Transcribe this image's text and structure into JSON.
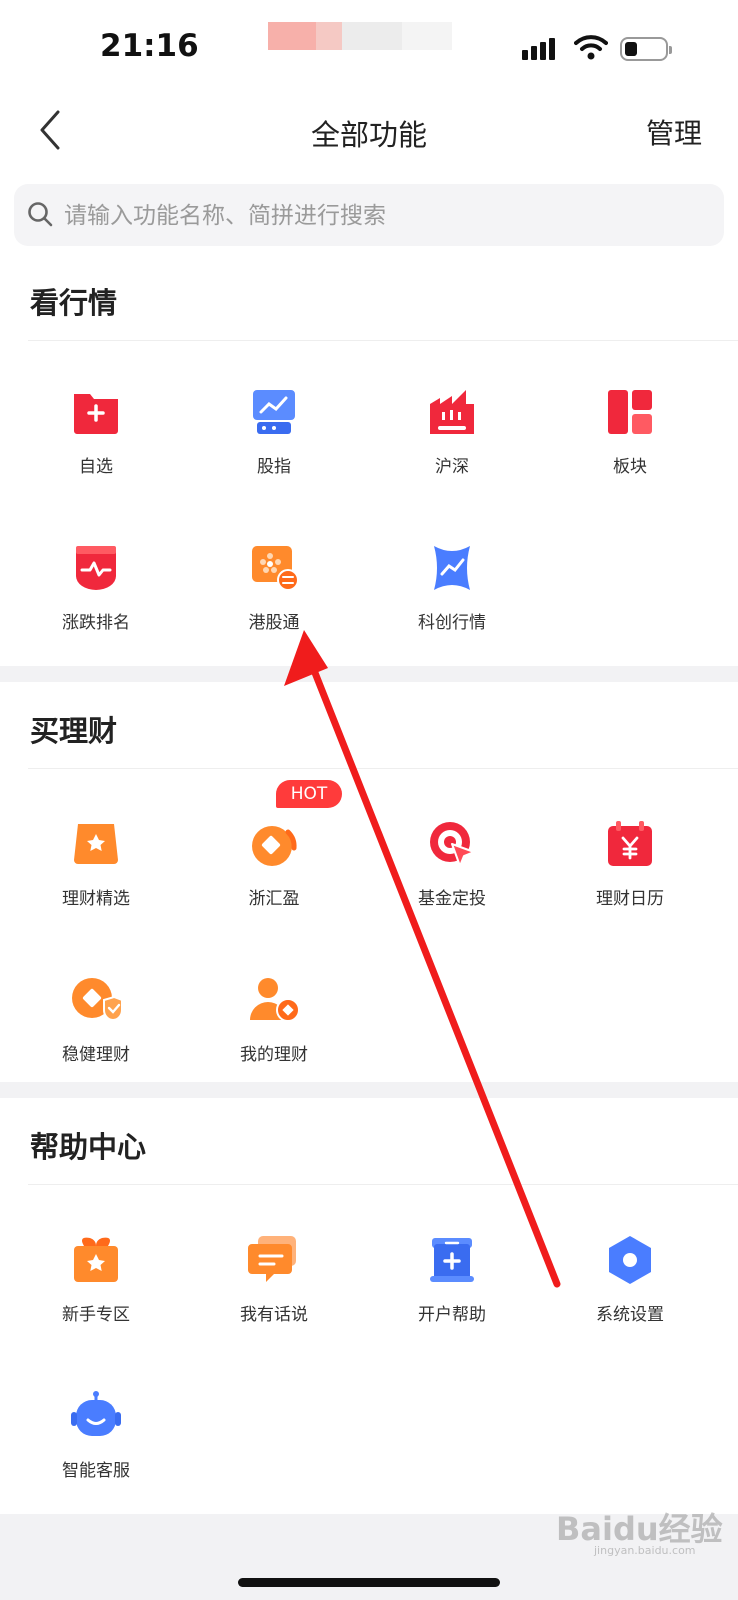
{
  "status_bar": {
    "time": "21:16"
  },
  "nav": {
    "title": "全部功能",
    "manage": "管理"
  },
  "search": {
    "placeholder": "请输入功能名称、简拼进行搜索"
  },
  "sections": [
    {
      "title": "看行情",
      "items": [
        {
          "label": "自选",
          "icon": "folder-plus-icon"
        },
        {
          "label": "股指",
          "icon": "index-chart-icon"
        },
        {
          "label": "沪深",
          "icon": "building-icon"
        },
        {
          "label": "板块",
          "icon": "grid-block-icon"
        },
        {
          "label": "涨跌排名",
          "icon": "pulse-shield-icon"
        },
        {
          "label": "港股通",
          "icon": "hk-exchange-icon"
        },
        {
          "label": "科创行情",
          "icon": "tech-chart-icon"
        }
      ]
    },
    {
      "title": "买理财",
      "items": [
        {
          "label": "理财精选",
          "icon": "star-bag-icon"
        },
        {
          "label": "浙汇盈",
          "icon": "coin-swirl-icon",
          "badge": "HOT"
        },
        {
          "label": "基金定投",
          "icon": "target-cursor-icon"
        },
        {
          "label": "理财日历",
          "icon": "yen-calendar-icon"
        },
        {
          "label": "稳健理财",
          "icon": "shield-coin-icon"
        },
        {
          "label": "我的理财",
          "icon": "user-coin-icon"
        }
      ]
    },
    {
      "title": "帮助中心",
      "items": [
        {
          "label": "新手专区",
          "icon": "gift-star-icon"
        },
        {
          "label": "我有话说",
          "icon": "chat-bubble-icon"
        },
        {
          "label": "开户帮助",
          "icon": "doc-plus-icon"
        },
        {
          "label": "系统设置",
          "icon": "hexagon-settings-icon"
        },
        {
          "label": "智能客服",
          "icon": "robot-icon"
        }
      ]
    }
  ],
  "watermark": {
    "text": "Baidu经验",
    "sub": "jingyan.baidu.com"
  },
  "colors": {
    "red": "#f0283c",
    "orange": "#ff8a2c",
    "blue": "#4a7dff",
    "arrow": "#f01c1c"
  }
}
